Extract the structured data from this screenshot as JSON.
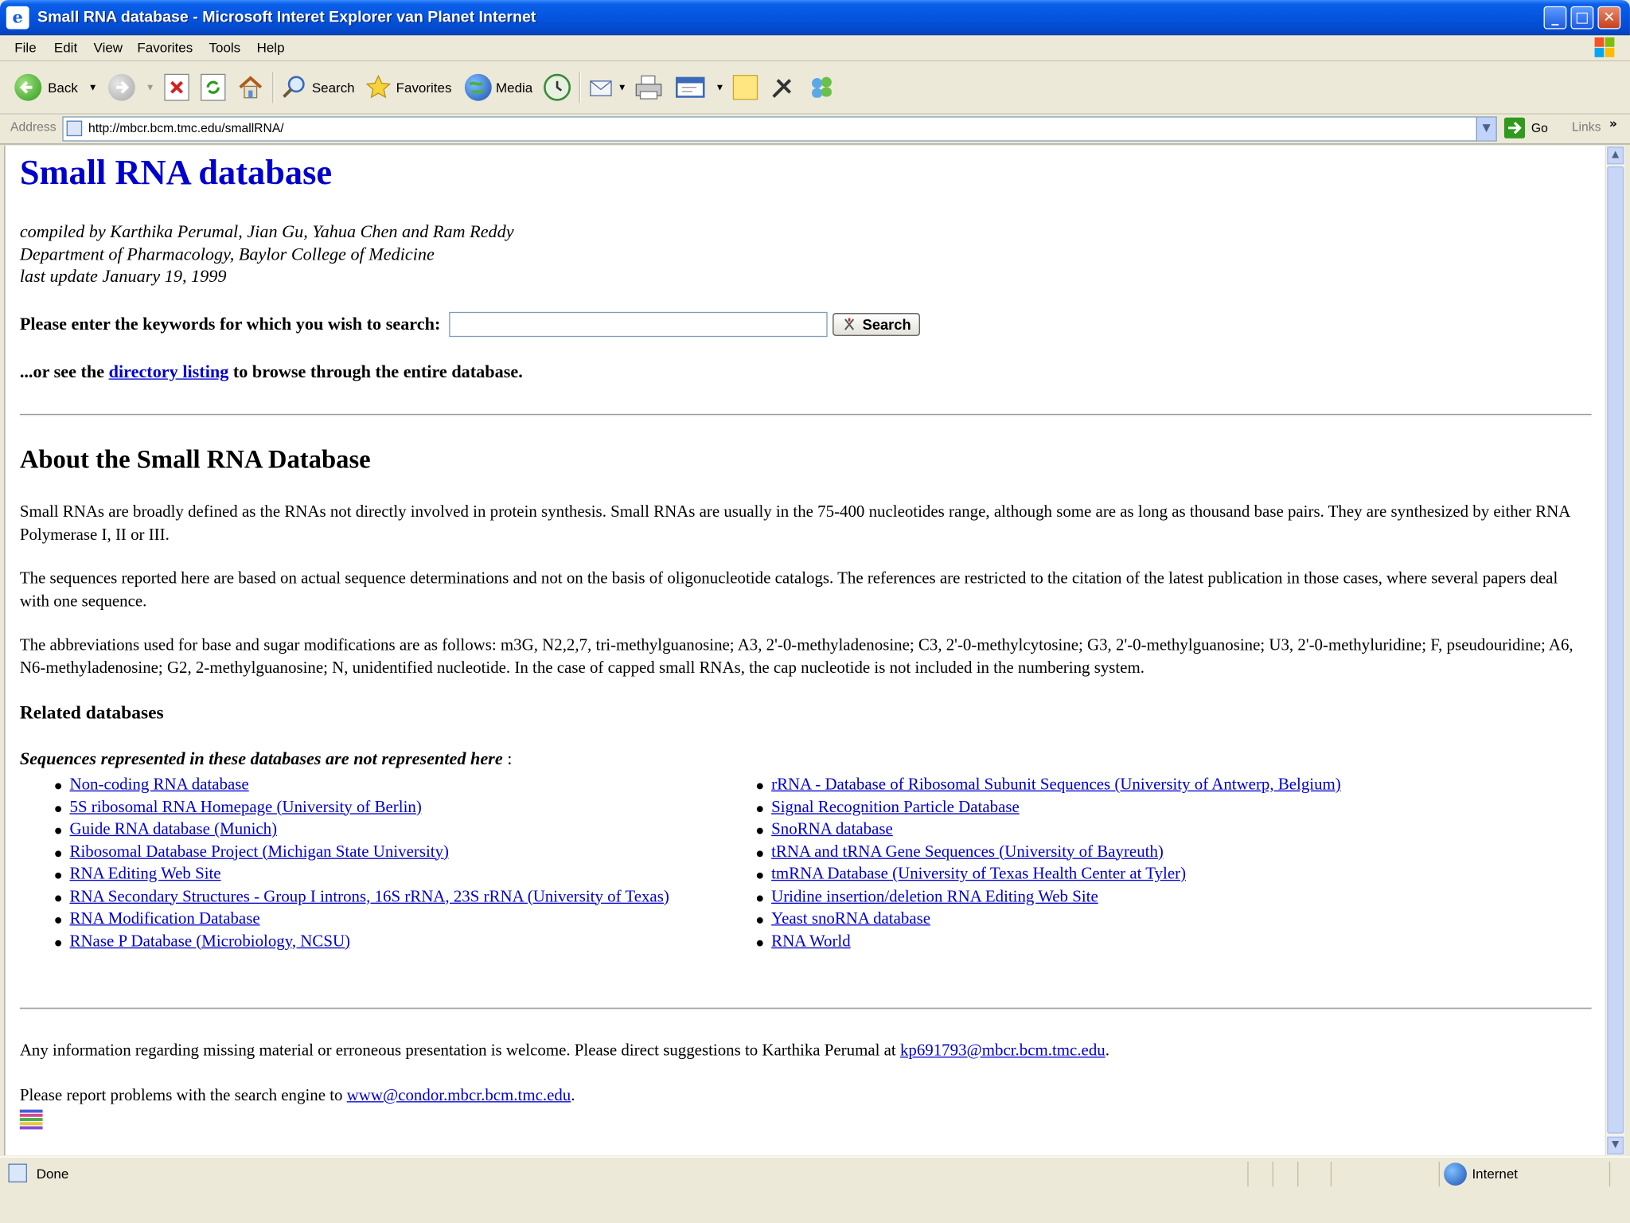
{
  "window": {
    "title": "Small RNA database - Microsoft Interet Explorer van Planet Internet"
  },
  "menu": [
    "File",
    "Edit",
    "View",
    "Favorites",
    "Tools",
    "Help"
  ],
  "toolbar": {
    "back": "Back",
    "search": "Search",
    "favorites": "Favorites",
    "media": "Media"
  },
  "address": {
    "label": "Address",
    "url": "http://mbcr.bcm.tmc.edu/smallRNA/",
    "go": "Go",
    "links": "Links"
  },
  "page": {
    "title": "Small RNA database",
    "credits": [
      "compiled by Karthika Perumal, Jian Gu, Yahua Chen and Ram Reddy",
      "Department of Pharmacology, Baylor College of Medicine",
      "last update January 19, 1999"
    ],
    "search_prompt": "Please enter the keywords for which you wish to search:",
    "search_value": "",
    "search_button": "Search",
    "browse_prefix": "...or see the ",
    "browse_link": "directory listing",
    "browse_suffix": " to browse through the entire database.",
    "about_heading": "About the Small RNA Database",
    "about_paragraphs": [
      "Small RNAs are broadly defined as the RNAs not directly involved in protein synthesis. Small RNAs are usually in the 75-400 nucleotides range, although some are as long as thousand base pairs. They are synthesized by either RNA Polymerase I, II or III.",
      "The sequences reported here are based on actual sequence determinations and not on the basis of oligonucleotide catalogs. The references are restricted to the citation of the latest publication in those cases, where several papers deal with one sequence.",
      "The abbreviations used for base and sugar modifications are as follows: m3G, N2,2,7, tri-methylguanosine; A3, 2'-0-methyladenosine; C3, 2'-0-methylcytosine; G3, 2'-0-methylguanosine; U3, 2'-0-methyluridine; F, pseudouridine; A6, N6-methyladenosine; G2, 2-methylguanosine; N, unidentified nucleotide. In the case of capped small RNAs, the cap nucleotide is not included in the numbering system."
    ],
    "related_heading": "Related databases",
    "related_note": "Sequences represented in these databases are not represented here",
    "related_note_suffix": " :",
    "related_left": [
      "Non-coding RNA database",
      "5S ribosomal RNA Homepage (University of Berlin)",
      "Guide RNA database (Munich)",
      "Ribosomal Database Project (Michigan State University)",
      "RNA Editing Web Site",
      "RNA Secondary Structures - Group I introns, 16S rRNA, 23S rRNA (University of Texas)",
      "RNA Modification Database",
      "RNase P Database (Microbiology, NCSU)"
    ],
    "related_right": [
      "rRNA - Database of Ribosomal Subunit Sequences (University of Antwerp, Belgium)",
      "Signal Recognition Particle Database",
      "SnoRNA database",
      "tRNA and tRNA Gene Sequences (University of Bayreuth)",
      "tmRNA Database (University of Texas Health Center at Tyler)",
      "Uridine insertion/deletion RNA Editing Web Site",
      "Yeast snoRNA database",
      "RNA World"
    ],
    "footer_info_prefix": "Any information regarding missing material or erroneous presentation is welcome. Please direct suggestions to Karthika Perumal at ",
    "footer_info_email": "kp691793@mbcr.bcm.tmc.edu",
    "footer_info_suffix": ".",
    "footer_search_prefix": "Please report problems with the search engine to ",
    "footer_search_email": "www@condor.mbcr.bcm.tmc.edu",
    "footer_search_suffix": "."
  },
  "status": {
    "text": "Done",
    "zone": "Internet"
  }
}
